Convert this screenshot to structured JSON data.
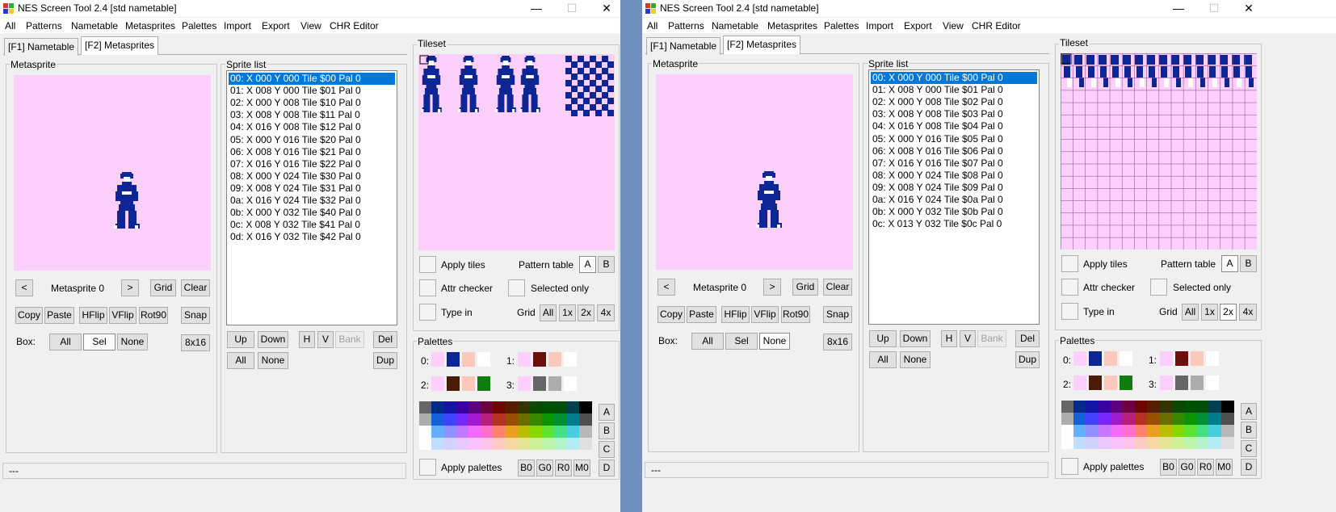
{
  "windows": [
    {
      "title": "NES Screen Tool 2.4  [std nametable]",
      "menu": [
        "All",
        "Patterns",
        "Nametable",
        "Metasprites",
        "Palettes",
        "Import",
        "Export",
        "View",
        "CHR Editor"
      ],
      "tabs": [
        "[F1] Nametable",
        "[F2] Metasprites"
      ],
      "active_tab": 1,
      "groups": {
        "metasprite": "Metasprite",
        "sprite_list": "Sprite list",
        "tileset": "Tileset",
        "palettes": "Palettes"
      },
      "metasprite_label": "Metasprite 0",
      "buttons": {
        "prev": "<",
        "next": ">",
        "grid": "Grid",
        "clear": "Clear",
        "copy": "Copy",
        "paste": "Paste",
        "hflip": "HFlip",
        "vflip": "VFlip",
        "rot90": "Rot90",
        "snap": "Snap",
        "box_label": "Box:",
        "box_all": "All",
        "box_sel": "Sel",
        "box_none": "None",
        "mode_8x16": "8x16",
        "up": "Up",
        "down": "Down",
        "h": "H",
        "v": "V",
        "bank": "Bank",
        "del": "Del",
        "all": "All",
        "none": "None",
        "dup": "Dup"
      },
      "box_selected": "Sel",
      "sprites": [
        "00: X 000 Y 000 Tile $00 Pal 0",
        "01: X 008 Y 000 Tile $01 Pal 0",
        "02: X 000 Y 008 Tile $10 Pal 0",
        "03: X 008 Y 008 Tile $11 Pal 0",
        "04: X 016 Y 008 Tile $12 Pal 0",
        "05: X 000 Y 016 Tile $20 Pal 0",
        "06: X 008 Y 016 Tile $21 Pal 0",
        "07: X 016 Y 016 Tile $22 Pal 0",
        "08: X 000 Y 024 Tile $30 Pal 0",
        "09: X 008 Y 024 Tile $31 Pal 0",
        "0a: X 016 Y 024 Tile $32 Pal 0",
        "0b: X 000 Y 032 Tile $40 Pal 0",
        "0c: X 008 Y 032 Tile $41 Pal 0",
        "0d: X 016 Y 032 Tile $42 Pal 0"
      ],
      "selected_sprite": 0,
      "tileset_controls": {
        "apply_tiles": "Apply tiles",
        "pattern_table": "Pattern table",
        "pt_a": "A",
        "pt_b": "B",
        "attr_checker": "Attr checker",
        "selected_only": "Selected only",
        "type_in": "Type in",
        "grid": "Grid",
        "grid_all": "All",
        "grid_1x": "1x",
        "grid_2x": "2x",
        "grid_4x": "4x"
      },
      "grid_selected": "",
      "tileset_gridlines": false,
      "palette_labels": [
        "0:",
        "1:",
        "2:",
        "3:"
      ],
      "apply_palettes": "Apply palettes",
      "pal_buttons": [
        "B0",
        "G0",
        "R0",
        "M0"
      ],
      "abcd": [
        "A",
        "B",
        "C",
        "D"
      ],
      "status": "---"
    },
    {
      "title": "NES Screen Tool 2.4  [std nametable]",
      "menu": [
        "All",
        "Patterns",
        "Nametable",
        "Metasprites",
        "Palettes",
        "Import",
        "Export",
        "View",
        "CHR Editor"
      ],
      "tabs": [
        "[F1] Nametable",
        "[F2] Metasprites"
      ],
      "active_tab": 1,
      "groups": {
        "metasprite": "Metasprite",
        "sprite_list": "Sprite list",
        "tileset": "Tileset",
        "palettes": "Palettes"
      },
      "metasprite_label": "Metasprite 0",
      "buttons": {
        "prev": "<",
        "next": ">",
        "grid": "Grid",
        "clear": "Clear",
        "copy": "Copy",
        "paste": "Paste",
        "hflip": "HFlip",
        "vflip": "VFlip",
        "rot90": "Rot90",
        "snap": "Snap",
        "box_label": "Box:",
        "box_all": "All",
        "box_sel": "Sel",
        "box_none": "None",
        "mode_8x16": "8x16",
        "up": "Up",
        "down": "Down",
        "h": "H",
        "v": "V",
        "bank": "Bank",
        "del": "Del",
        "all": "All",
        "none": "None",
        "dup": "Dup"
      },
      "box_selected": "None",
      "sprites": [
        "00: X 000 Y 000 Tile $00 Pal 0",
        "01: X 008 Y 000 Tile $01 Pal 0",
        "02: X 000 Y 008 Tile $02 Pal 0",
        "03: X 008 Y 008 Tile $03 Pal 0",
        "04: X 016 Y 008 Tile $04 Pal 0",
        "05: X 000 Y 016 Tile $05 Pal 0",
        "06: X 008 Y 016 Tile $06 Pal 0",
        "07: X 016 Y 016 Tile $07 Pal 0",
        "08: X 000 Y 024 Tile $08 Pal 0",
        "09: X 008 Y 024 Tile $09 Pal 0",
        "0a: X 016 Y 024 Tile $0a Pal 0",
        "0b: X 000 Y 032 Tile $0b Pal 0",
        "0c: X 013 Y 032 Tile $0c Pal 0"
      ],
      "selected_sprite": 0,
      "tileset_controls": {
        "apply_tiles": "Apply tiles",
        "pattern_table": "Pattern table",
        "pt_a": "A",
        "pt_b": "B",
        "attr_checker": "Attr checker",
        "selected_only": "Selected only",
        "type_in": "Type in",
        "grid": "Grid",
        "grid_all": "All",
        "grid_1x": "1x",
        "grid_2x": "2x",
        "grid_4x": "4x"
      },
      "grid_selected": "2x",
      "tileset_gridlines": true,
      "palette_labels": [
        "0:",
        "1:",
        "2:",
        "3:"
      ],
      "apply_palettes": "Apply palettes",
      "pal_buttons": [
        "B0",
        "G0",
        "R0",
        "M0"
      ],
      "abcd": [
        "A",
        "B",
        "C",
        "D"
      ],
      "status": "---"
    }
  ],
  "colors": {
    "desktop": "#7190bd",
    "canvas_bg": "#fccffc",
    "sprite_blue": "#0d2694",
    "selection": "#0078d7"
  },
  "palettes_sets": [
    [
      "#fccffc",
      "#0d2694",
      "#fcc8bc",
      "#ffffff"
    ],
    [
      "#fccffc",
      "#6c0f0a",
      "#fcc8bc",
      "#ffffff"
    ],
    [
      "#fccffc",
      "#4a1c06",
      "#fcc8bc",
      "#0e7d0e"
    ],
    [
      "#fccffc",
      "#666666",
      "#adadad",
      "#ffffff"
    ]
  ],
  "nes_palette": [
    [
      "#666666",
      "#002a88",
      "#1412a7",
      "#3b00a4",
      "#5c007e",
      "#6e0040",
      "#6c0600",
      "#561d00",
      "#333500",
      "#0b4800",
      "#005200",
      "#004f08",
      "#00404d",
      "#000000"
    ],
    [
      "#adadad",
      "#155fd9",
      "#4240ff",
      "#7527fe",
      "#a01acc",
      "#b71e7b",
      "#b53120",
      "#994e00",
      "#6b6d00",
      "#388700",
      "#0c9300",
      "#008f32",
      "#007c8d",
      "#4f4f4f"
    ],
    [
      "#fffeff",
      "#64b0ff",
      "#9290ff",
      "#c676ff",
      "#f36aff",
      "#fe6ecc",
      "#fe8170",
      "#ea9e22",
      "#bcbe00",
      "#88d800",
      "#5ce430",
      "#45e082",
      "#48cdde",
      "#b8b8b8"
    ],
    [
      "#fffeff",
      "#c0dfff",
      "#d3d2ff",
      "#e8c8ff",
      "#fbc2ff",
      "#fec4ea",
      "#fecbc4",
      "#f7d8a5",
      "#e4e594",
      "#cfef96",
      "#bdf4ab",
      "#b3f3cc",
      "#b5ebf2",
      "#e0e0e0"
    ]
  ]
}
